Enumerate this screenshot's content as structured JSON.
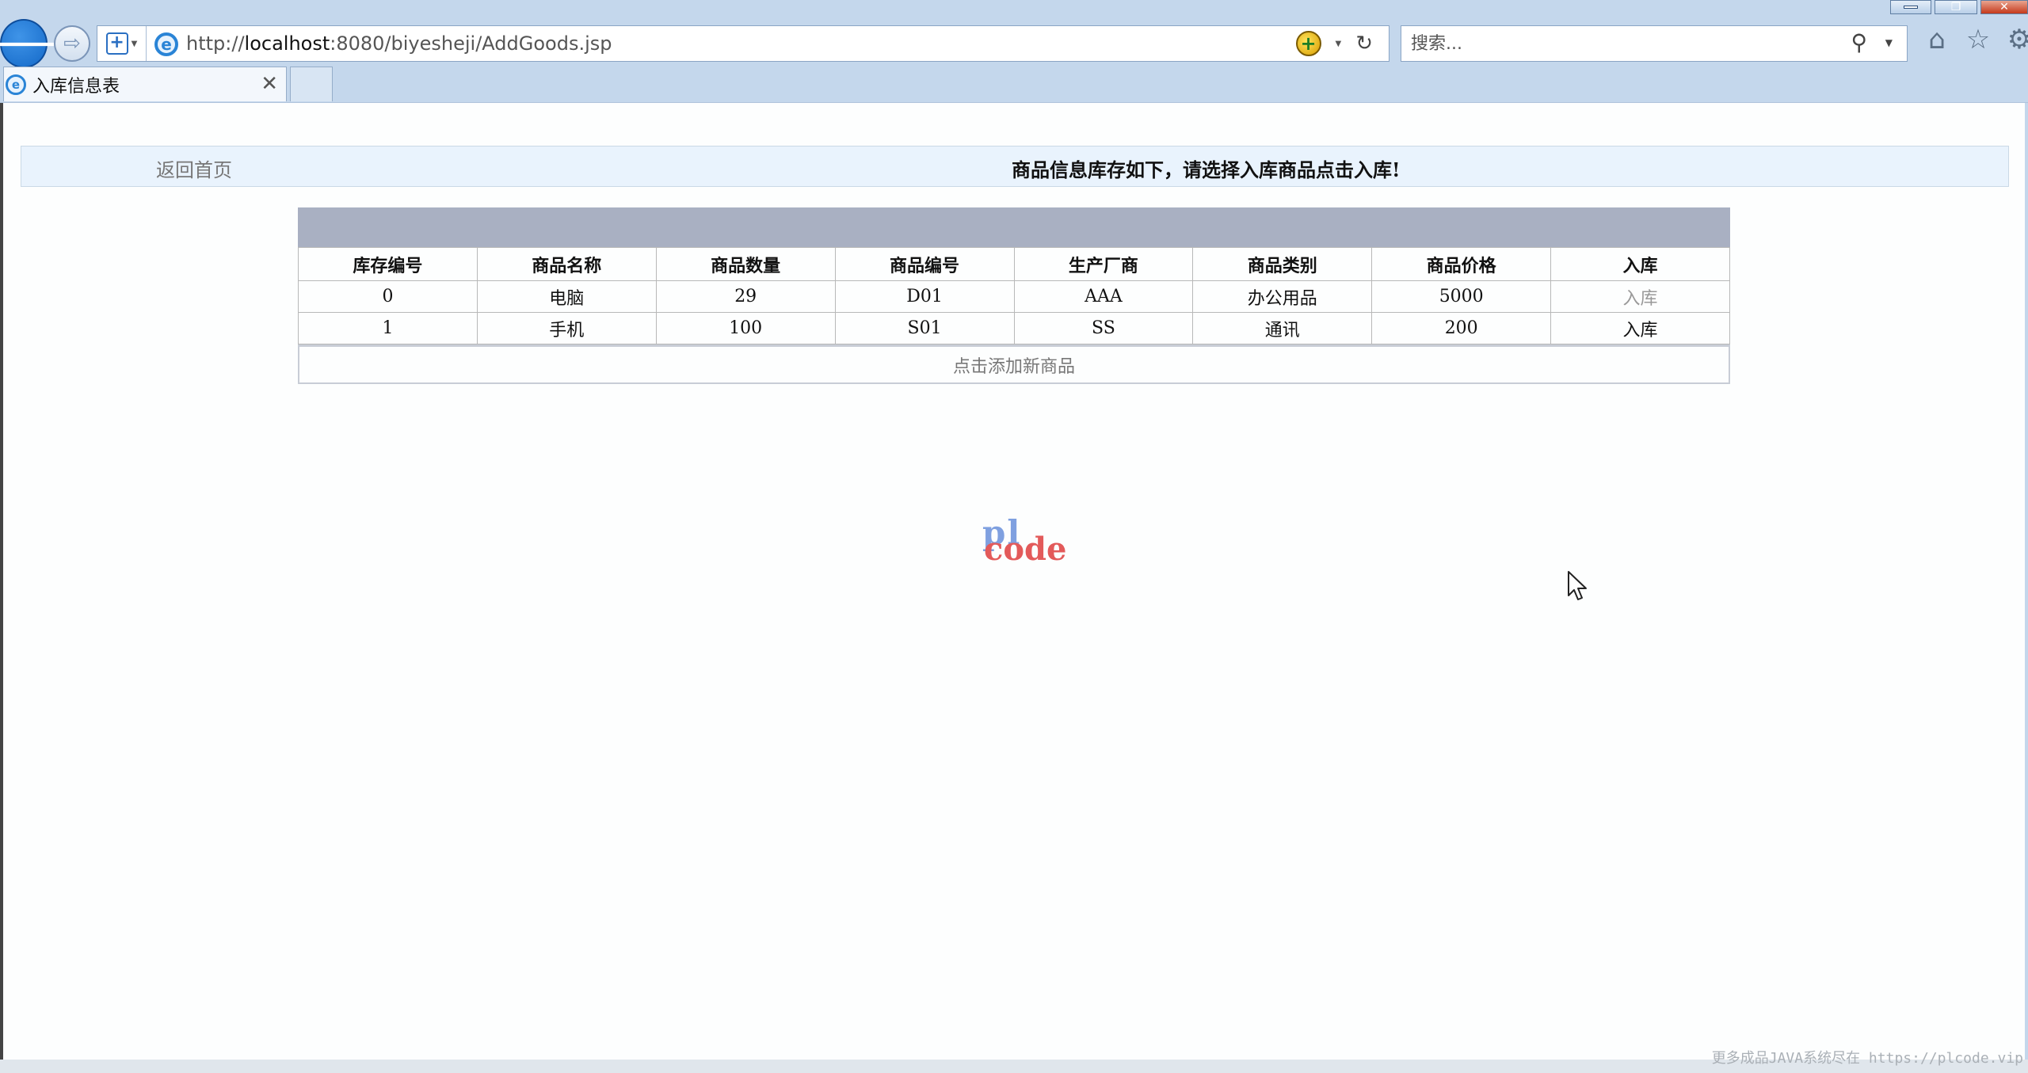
{
  "browser": {
    "url_prefix": "http://",
    "url_host": "localhost",
    "url_rest": ":8080/biyesheji/AddGoods.jsp",
    "search_placeholder": "搜索...",
    "tab_title": "入库信息表"
  },
  "page": {
    "home_link": "返回首页",
    "notice": "商品信息库存如下，请选择入库商品点击入库!",
    "table": {
      "headers": [
        "库存编号",
        "商品名称",
        "商品数量",
        "商品编号",
        "生产厂商",
        "商品类别",
        "商品价格",
        "入库"
      ],
      "rows": [
        [
          "0",
          "电脑",
          "29",
          "D01",
          "AAA",
          "办公用品",
          "5000",
          "入库"
        ],
        [
          "1",
          "手机",
          "100",
          "S01",
          "SS",
          "通讯",
          "200",
          "入库"
        ]
      ]
    },
    "add_new": "点击添加新商品",
    "logo_top": "pl",
    "logo_bottom": "code",
    "watermark": "更多成品JAVA系统尽在 https://plcode.vip"
  }
}
